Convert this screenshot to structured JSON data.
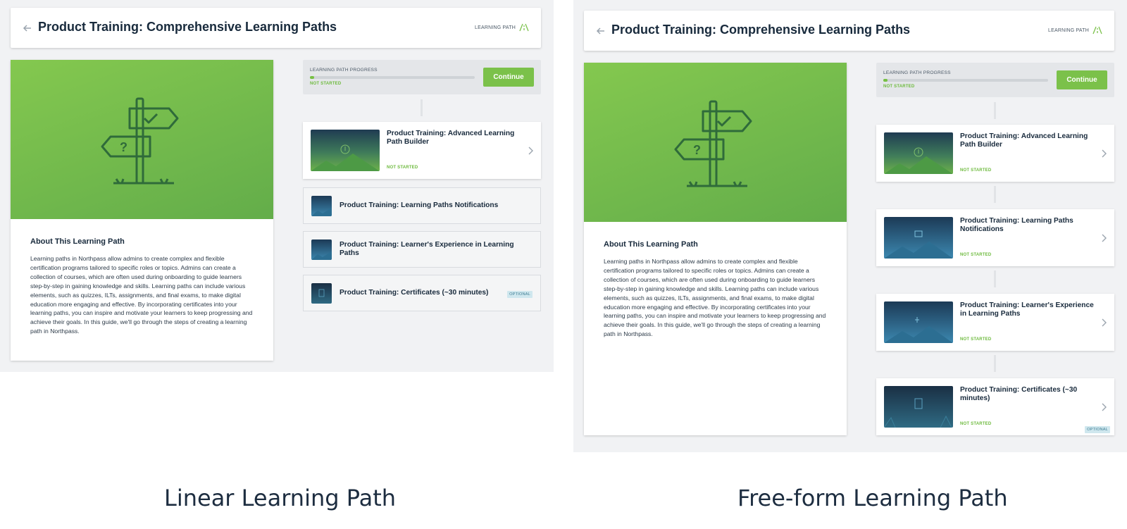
{
  "shared": {
    "page_title": "Product Training: Comprehensive Learning Paths",
    "tag_label": "LEARNING PATH",
    "about_title": "About This Learning Path",
    "about_text": "Learning paths in Northpass allow admins to create complex and flexible certification programs tailored to specific roles or topics. Admins can create a collection of courses, which are often used during onboarding to guide learners step-by-step in gaining knowledge and skills. Learning paths can include various elements, such as quizzes, ILTs, assignments, and final exams, to make digital education more engaging and effective. By incorporating certificates into your learning paths, you can inspire and motivate your learners to keep progressing and achieve their goals. In this guide, we'll go through the steps of creating a learning path in Northpass.",
    "progress_label": "LEARNING PATH PROGRESS",
    "progress_status": "NOT STARTED",
    "progress_value": 0.02,
    "continue_label": "Continue",
    "accent_color": "#7bc14a"
  },
  "linear": {
    "caption": "Linear Learning Path",
    "courses": [
      {
        "title": "Product Training: Advanced Learning Path Builder",
        "status": "NOT STARTED",
        "state": "unlocked"
      },
      {
        "title": "Product Training: Learning Paths Notifications",
        "state": "locked"
      },
      {
        "title": "Product Training: Learner's Experience in Learning Paths",
        "state": "locked"
      },
      {
        "title": "Product Training: Certificates (~30 minutes)",
        "badge": "OPTIONAL",
        "state": "locked"
      }
    ]
  },
  "freeform": {
    "caption": "Free-form Learning Path",
    "courses": [
      {
        "title": "Product Training: Advanced Learning Path Builder",
        "status": "NOT STARTED"
      },
      {
        "title": "Product Training: Learning Paths Notifications",
        "status": "NOT STARTED"
      },
      {
        "title": "Product Training: Learner's Experience in Learning Paths",
        "status": "NOT STARTED"
      },
      {
        "title": "Product Training: Certificates (~30 minutes)",
        "status": "NOT STARTED",
        "badge": "OPTIONAL"
      }
    ]
  }
}
